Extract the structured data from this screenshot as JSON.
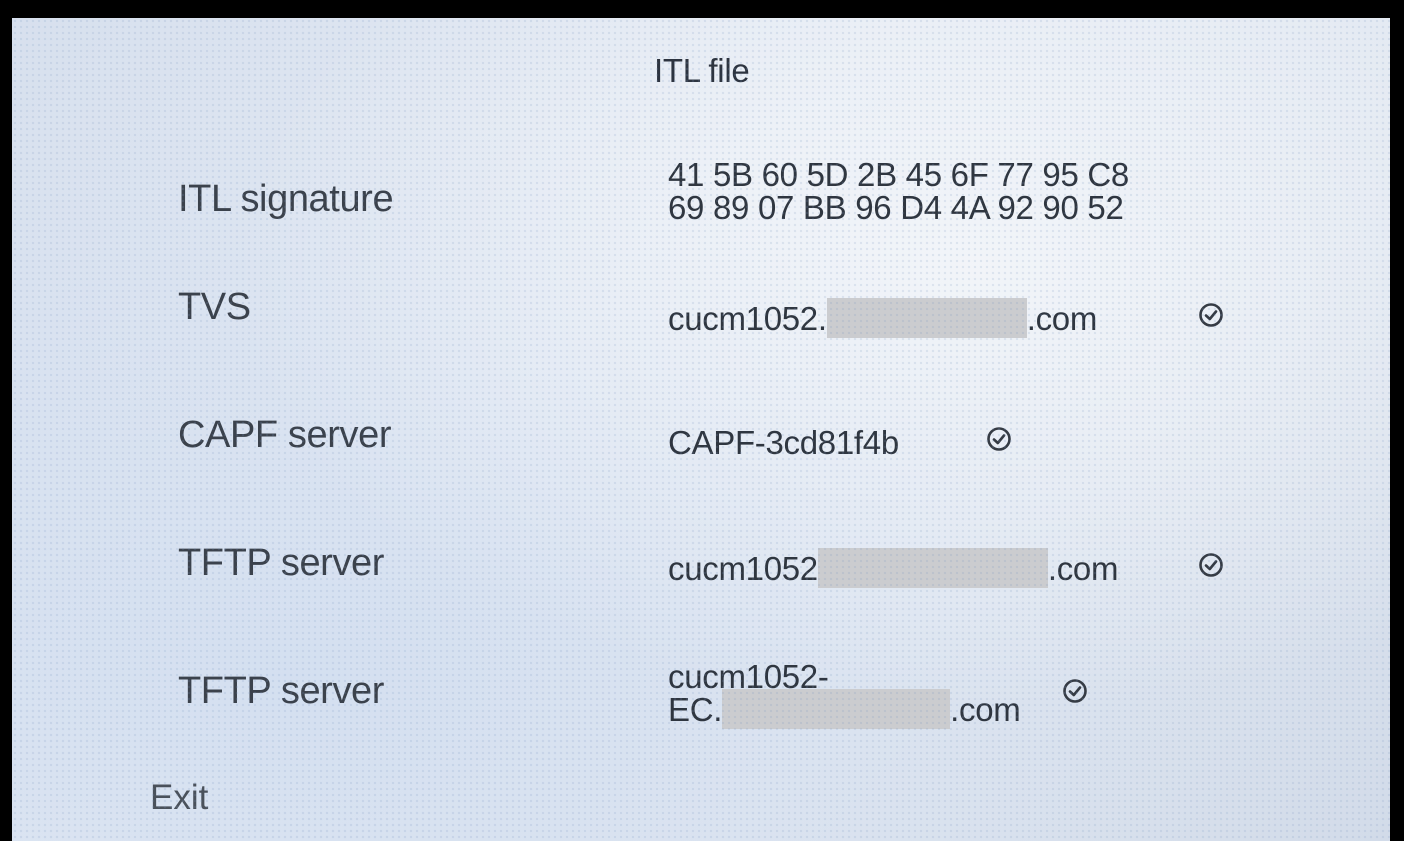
{
  "screen": {
    "title": "ITL file"
  },
  "rows": [
    {
      "label": "ITL signature",
      "value_line1": "41 5B 60 5D 2B 45 6F 77 95 C8",
      "value_line2": "69 89 07 BB 96 D4 4A 92 90 52"
    },
    {
      "label": "TVS",
      "value_prefix": "cucm1052.",
      "value_suffix": ".com",
      "status": "verified"
    },
    {
      "label": "CAPF server",
      "value": "CAPF-3cd81f4b",
      "status": "verified"
    },
    {
      "label": "TFTP server",
      "value_prefix": "cucm1052",
      "value_suffix": ".com",
      "status": "verified"
    },
    {
      "label": "TFTP server",
      "value_line1": "cucm1052-",
      "value_prefix": "EC.",
      "value_suffix": ".com",
      "status": "verified"
    }
  ],
  "footer": {
    "exit_label": "Exit"
  },
  "icons": {
    "status_icon": "check-circle-icon"
  },
  "colors": {
    "background": "#dfe6f0",
    "text": "#2f3640",
    "redaction": "#cbcccf"
  }
}
